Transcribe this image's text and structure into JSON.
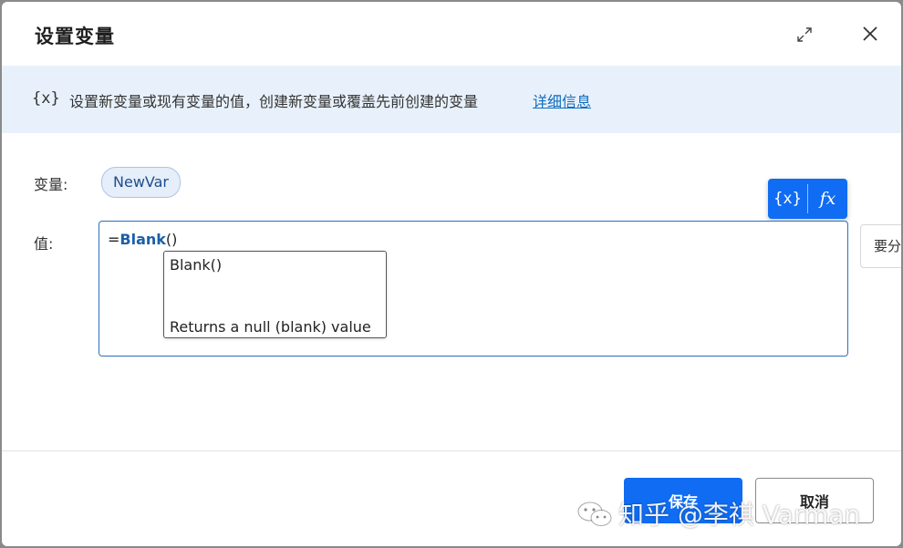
{
  "dialog": {
    "title": "设置变量",
    "expand_icon": "expand-icon",
    "close_icon": "close-icon"
  },
  "info": {
    "icon_text": "{x}",
    "text": "设置新变量或现有变量的值，创建新变量或覆盖先前创建的变量",
    "link": "详细信息"
  },
  "form": {
    "variable_label": "变量:",
    "variable_name": "NewVar",
    "value_label": "值:",
    "value_prefix": "=",
    "value_function": "Blank",
    "value_suffix": "()"
  },
  "toolbar": {
    "variables_button": "{x}",
    "formula_button": "fx"
  },
  "side_chip": "要分",
  "suggestion": {
    "signature": "Blank()",
    "description": "Returns a null (blank) value"
  },
  "footer": {
    "save": "保存",
    "cancel": "取消"
  },
  "watermark": "知乎 @李祺 Varman",
  "colors": {
    "accent": "#0f6cf3",
    "info_bg": "#e8f1fb",
    "link": "#0f6cbd"
  }
}
